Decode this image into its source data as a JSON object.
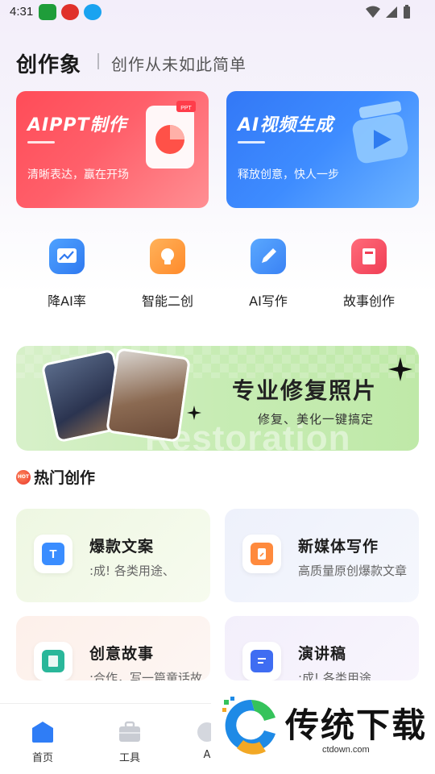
{
  "status_bar": {
    "time": "4:31"
  },
  "header": {
    "brand": "创作象",
    "slogan": "创作从未如此简单"
  },
  "hero_cards": [
    {
      "title": "AIPPT制作",
      "subtitle": "清晰表达，赢在开场",
      "badge": "PPT"
    },
    {
      "title": "AI视频生成",
      "subtitle": "释放创意，快人一步"
    }
  ],
  "quick_tools": [
    {
      "label": "降AI率",
      "icon": "chart-icon"
    },
    {
      "label": "智能二创",
      "icon": "lightbulb-icon"
    },
    {
      "label": "AI写作",
      "icon": "pen-icon"
    },
    {
      "label": "故事创作",
      "icon": "book-icon"
    }
  ],
  "banner": {
    "title": "专业修复照片",
    "subtitle": "修复、美化一键搞定",
    "watermark": "Restoration"
  },
  "section": {
    "title": "热门创作",
    "hot_badge": "HOT"
  },
  "cards": [
    {
      "title": "爆款文案",
      "subtitle": ":成!        各类用途、",
      "icon_text": "T"
    },
    {
      "title": "新媒体写作",
      "subtitle": "高质量原创爆款文章",
      "icon_text": ""
    },
    {
      "title": "创意故事",
      "subtitle": ":合作，写一篇童话故",
      "icon_text": ""
    },
    {
      "title": "演讲稿",
      "subtitle": ":成!        各类用途",
      "icon_text": ""
    }
  ],
  "bottom_nav": [
    {
      "label": "首页"
    },
    {
      "label": "工具"
    },
    {
      "label": "A"
    }
  ],
  "watermark": {
    "text": "传统下载",
    "url": "ctdown.com"
  }
}
